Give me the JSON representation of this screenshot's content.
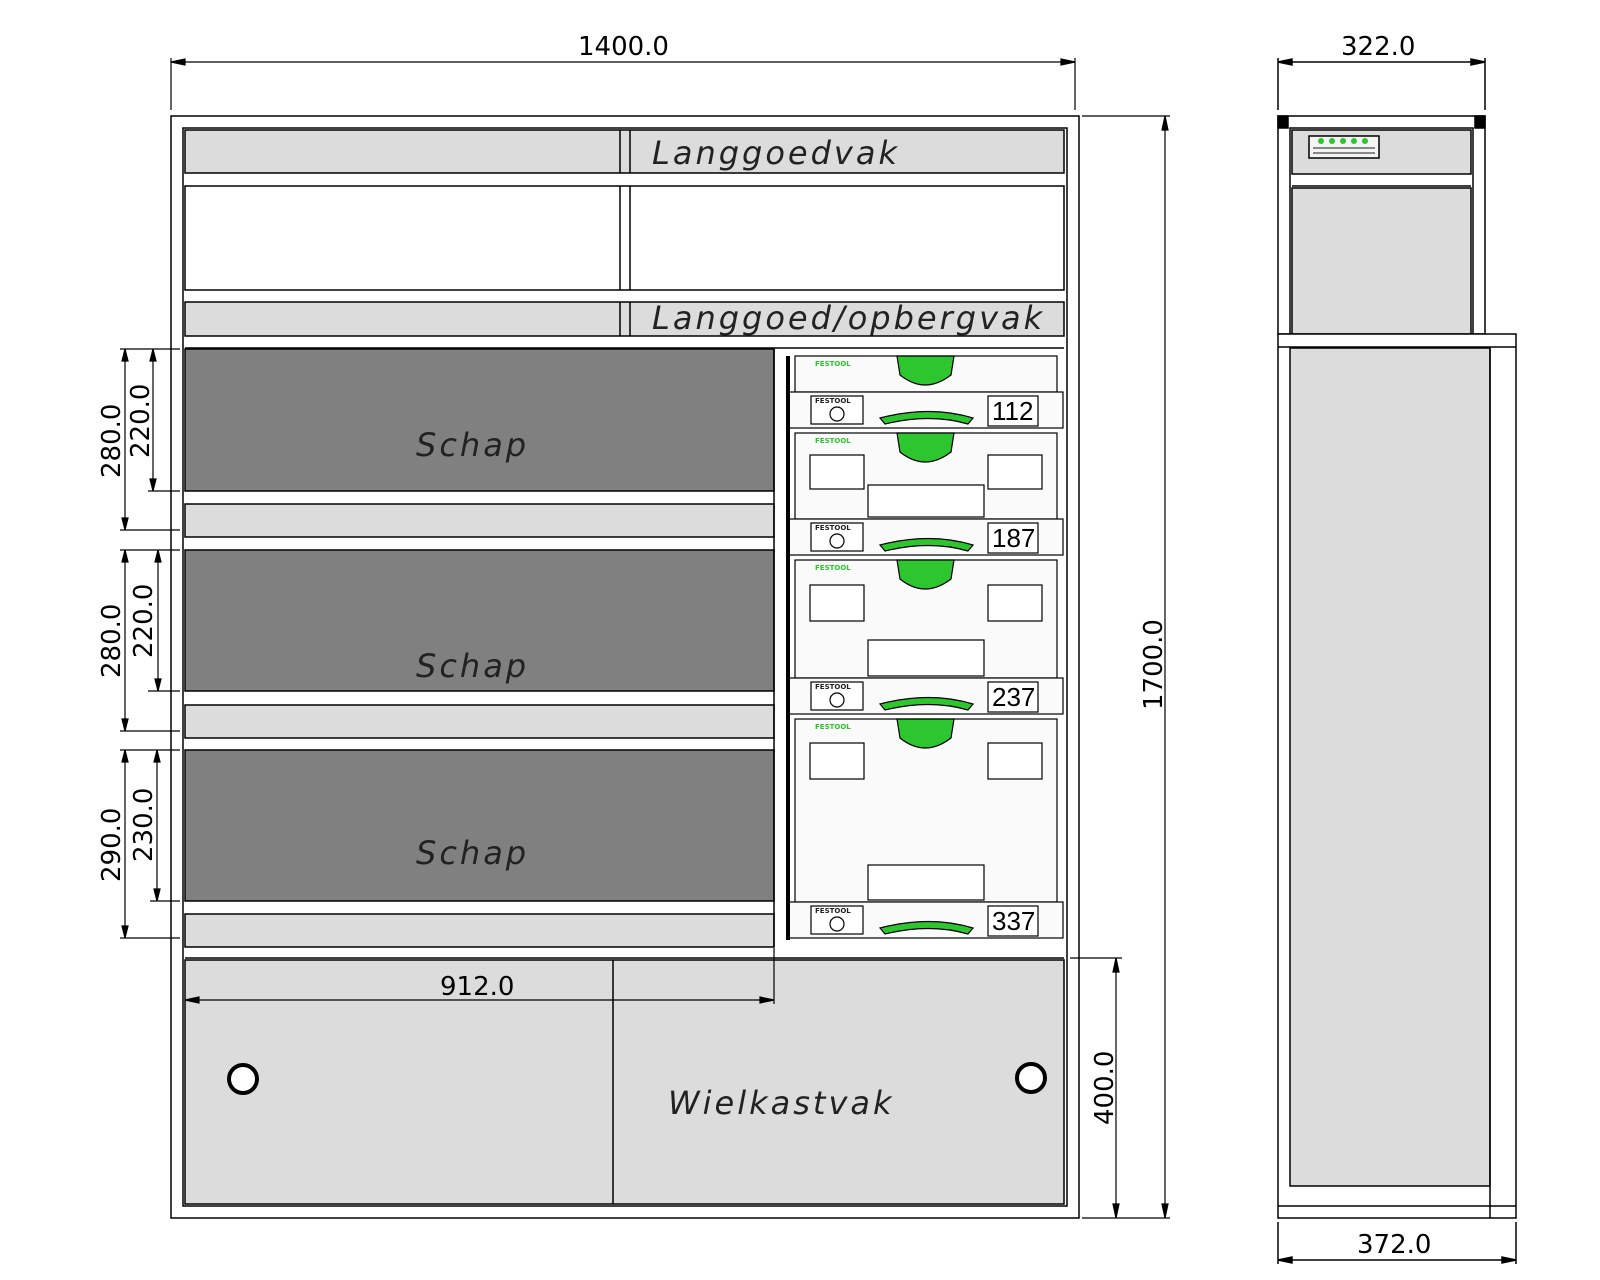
{
  "dimensions": {
    "width_total": "1400.0",
    "height_total": "1700.0",
    "depth_top": "322.0",
    "depth_bottom": "372.0",
    "shelf_outer_1": "280.0",
    "shelf_inner_1": "220.0",
    "shelf_outer_2": "280.0",
    "shelf_inner_2": "220.0",
    "shelf_outer_3": "290.0",
    "shelf_inner_3": "230.0",
    "width_shelves": "912.0",
    "height_wheel": "400.0"
  },
  "labels": {
    "top_compartment": "Langgoedvak",
    "second_compartment": "Langgoed/opbergvak",
    "shelf": "Schap",
    "wheel_compartment": "Wielkastvak"
  },
  "systainers": {
    "brand": "FESTOOL",
    "sizes": [
      "112",
      "187",
      "237",
      "337"
    ]
  },
  "colors": {
    "line": "#000000",
    "panel_light": "#dcdcdc",
    "shelf_dark": "#808080",
    "accent_green": "#2ec62e"
  }
}
